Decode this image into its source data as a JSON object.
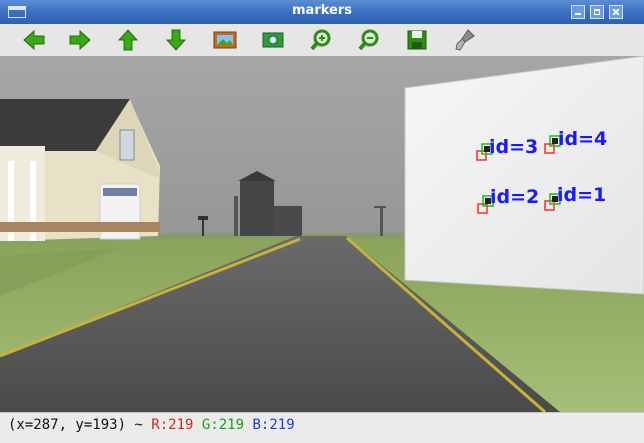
{
  "window": {
    "title": "markers"
  },
  "toolbar": {
    "tools": [
      {
        "name": "left-arrow-icon"
      },
      {
        "name": "right-arrow-icon"
      },
      {
        "name": "up-arrow-icon"
      },
      {
        "name": "down-arrow-icon"
      },
      {
        "name": "image-icon"
      },
      {
        "name": "zoom-fit-icon"
      },
      {
        "name": "zoom-in-icon"
      },
      {
        "name": "zoom-out-icon"
      },
      {
        "name": "save-icon"
      },
      {
        "name": "brush-icon"
      }
    ],
    "colors": {
      "arrow": "#3aa815",
      "save": "#2e8a1a"
    }
  },
  "viewport": {
    "markers": [
      {
        "label": "id=3"
      },
      {
        "label": "id=4"
      },
      {
        "label": "id=2"
      },
      {
        "label": "id=1"
      }
    ],
    "colors": {
      "label": "#1a1aff",
      "corner_red": "#ff2a2a",
      "corner_green": "#18c018"
    }
  },
  "status": {
    "coords": "(x=287, y=193) ~ ",
    "r": "R:219",
    "g": "G:219",
    "b": "B:219"
  }
}
